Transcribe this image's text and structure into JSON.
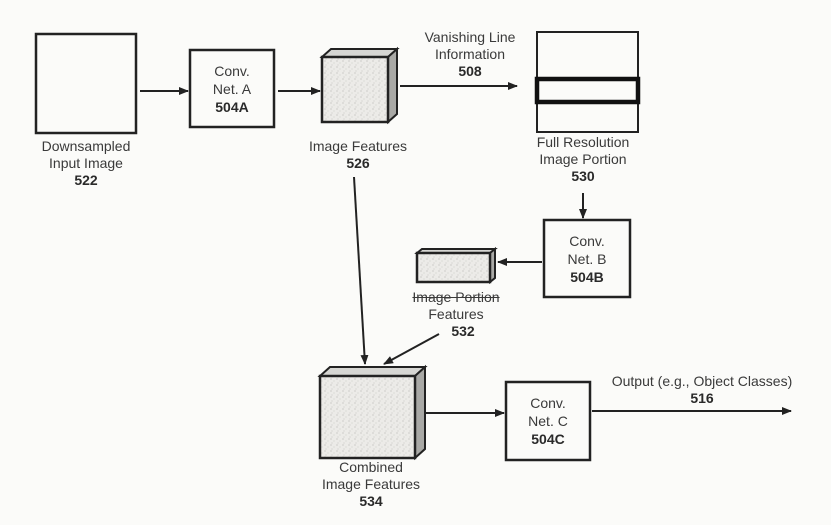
{
  "diagram": {
    "nodes": {
      "input_image": {
        "label_lines": [
          "Downsampled",
          "Input Image"
        ],
        "number": "522"
      },
      "conv_a": {
        "label_lines": [
          "Conv.",
          "Net. A"
        ],
        "number": "504A"
      },
      "image_features": {
        "label_lines": [
          "Image Features"
        ],
        "number": "526"
      },
      "full_res_portion": {
        "label_lines": [
          "Full Resolution",
          "Image Portion"
        ],
        "number": "530"
      },
      "conv_b": {
        "label_lines": [
          "Conv.",
          "Net. B"
        ],
        "number": "504B"
      },
      "portion_features": {
        "label_lines": [
          "Image Portion",
          "Features"
        ],
        "number": "532"
      },
      "combined_features": {
        "label_lines": [
          "Combined",
          "Image Features"
        ],
        "number": "534"
      },
      "conv_c": {
        "label_lines": [
          "Conv.",
          "Net. C"
        ],
        "number": "504C"
      }
    },
    "edges": {
      "vanishing_line": {
        "label_lines": [
          "Vanishing Line",
          "Information"
        ],
        "number": "508"
      },
      "output": {
        "label_lines": [
          "Output (e.g., Object Classes)"
        ],
        "number": "516"
      }
    },
    "connections": [
      {
        "from": "input_image",
        "to": "conv_a"
      },
      {
        "from": "conv_a",
        "to": "image_features"
      },
      {
        "from": "image_features",
        "to": "full_res_portion",
        "label": "vanishing_line"
      },
      {
        "from": "full_res_portion",
        "to": "conv_b"
      },
      {
        "from": "conv_b",
        "to": "portion_features"
      },
      {
        "from": "image_features",
        "to": "combined_features"
      },
      {
        "from": "portion_features",
        "to": "combined_features"
      },
      {
        "from": "combined_features",
        "to": "conv_c"
      },
      {
        "from": "conv_c",
        "to": "output",
        "label": "output"
      }
    ]
  }
}
